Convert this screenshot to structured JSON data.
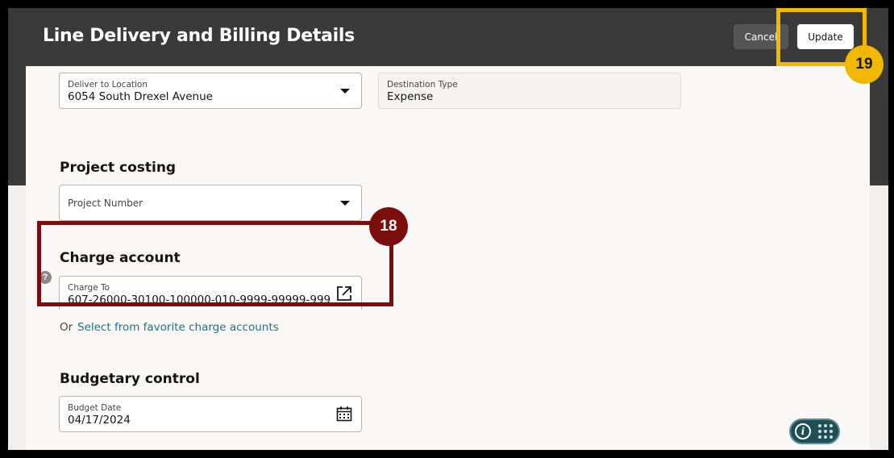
{
  "header": {
    "title": "Line Delivery and Billing Details",
    "cancel_label": "Cancel",
    "update_label": "Update"
  },
  "delivery": {
    "deliver_to_label": "Deliver to Location",
    "deliver_to_value": "6054 South Drexel Avenue",
    "destination_type_label": "Destination Type",
    "destination_type_value": "Expense"
  },
  "project_costing": {
    "title": "Project costing",
    "project_number_placeholder": "Project Number"
  },
  "charge_account": {
    "title": "Charge account",
    "help_icon": "?",
    "charge_to_label": "Charge To",
    "charge_to_value": "607-26000-30100-100000-010-9999-99999-999",
    "or_text": "Or",
    "favorite_link": "Select from favorite charge accounts"
  },
  "budgetary_control": {
    "title": "Budgetary control",
    "budget_date_label": "Budget Date",
    "budget_date_value": "04/17/2024"
  },
  "annotations": {
    "step_18": "18",
    "step_19": "19"
  },
  "widget": {
    "info_glyph": "i"
  },
  "colors": {
    "header_bg": "#3a3a3a",
    "link": "#1f6f8b",
    "annotation_red": "#7b0d0d",
    "annotation_yellow": "#f2b800"
  }
}
